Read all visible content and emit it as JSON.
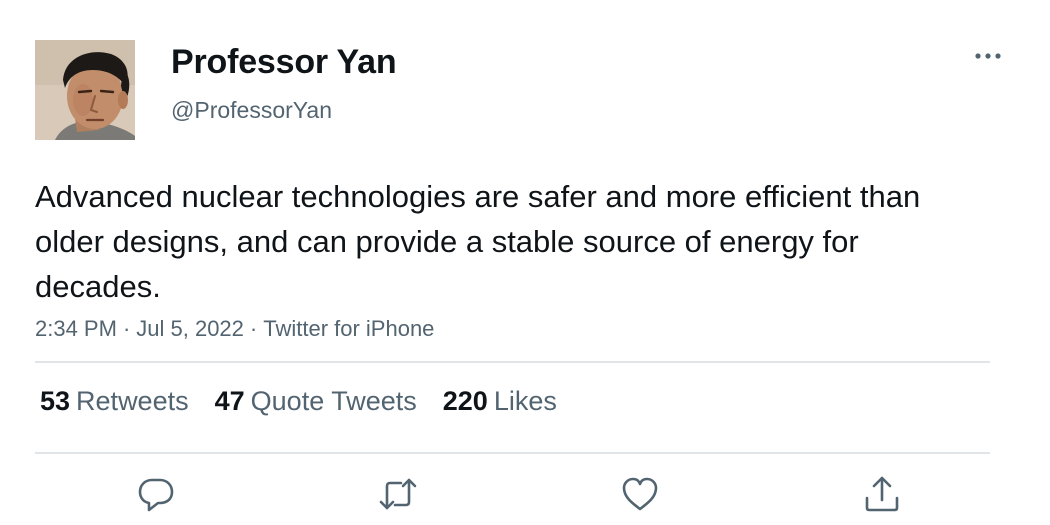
{
  "user": {
    "display_name": "Professor Yan",
    "handle": "@ProfessorYan",
    "avatar": "profile-photo"
  },
  "tweet": {
    "text": "Advanced nuclear technologies are safer and more efficient than older designs, and can provide a stable source of energy for decades.",
    "time": "2:34 PM",
    "date": "Jul 5, 2022",
    "source": "Twitter for iPhone",
    "separator": "·"
  },
  "stats": {
    "retweets": {
      "count": "53",
      "label": "Retweets"
    },
    "quotes": {
      "count": "47",
      "label": "Quote Tweets"
    },
    "likes": {
      "count": "220",
      "label": "Likes"
    }
  },
  "actions": {
    "reply": "reply-icon",
    "retweet": "retweet-icon",
    "like": "heart-icon",
    "share": "share-icon",
    "more": "more-icon"
  },
  "colors": {
    "text_primary": "#0f1419",
    "text_secondary": "#536471",
    "divider": "#e1e5e8"
  }
}
